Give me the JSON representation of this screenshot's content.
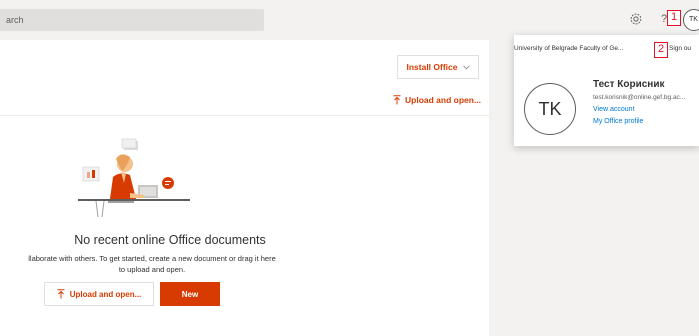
{
  "colors": {
    "accent": "#d83b01",
    "link": "#0078d4",
    "marker": "#e81123"
  },
  "topbar": {
    "search_text": "arch",
    "gear_icon": "gear-icon",
    "help_text": "?",
    "avatar_initials": "TK"
  },
  "markers": {
    "one": "1",
    "two": "2"
  },
  "toolbar": {
    "install_label": "Install Office",
    "install_chevron": "chevron-down-icon",
    "upload_label": "Upload and open..."
  },
  "empty": {
    "title": "No recent online Office documents",
    "desc_line1": "llaborate with others. To get started, create a new document or drag it here",
    "desc_line2": "to upload and open.",
    "upload_label": "Upload and open...",
    "new_label": "New"
  },
  "account": {
    "org": "University of Belgrade Faculty of Ge...",
    "signout": "Sign ou",
    "initials": "TK",
    "name": "Тест Корисник",
    "email": "test.korisnik@online.gef.bg.ac...",
    "view_account": "View account",
    "office_profile": "My Office profile"
  }
}
